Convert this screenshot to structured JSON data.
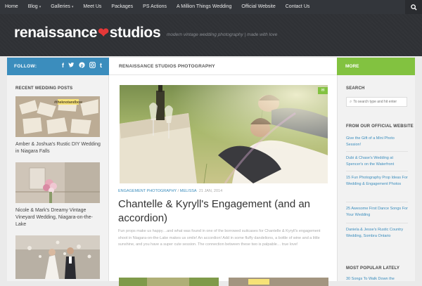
{
  "nav": {
    "items": [
      {
        "label": "Home"
      },
      {
        "label": "Blog",
        "caret": "▾"
      },
      {
        "label": "Galleries",
        "caret": "▾"
      },
      {
        "label": "Meet Us"
      },
      {
        "label": "Packages"
      },
      {
        "label": "PS Actions"
      },
      {
        "label": "A Million Things Wedding"
      },
      {
        "label": "Official Website"
      },
      {
        "label": "Contact Us"
      }
    ]
  },
  "header": {
    "logo_left": "renaissance",
    "logo_heart": "❤",
    "logo_right": "studios",
    "tagline": "modern vintage wedding photography | made with love"
  },
  "follow": {
    "label": "FOLLOW:",
    "icons": [
      "facebook-icon",
      "twitter-icon",
      "pinterest-icon",
      "instagram-icon",
      "tumblr-icon"
    ],
    "glyphs": [
      "f",
      "t",
      "p",
      "◎",
      "t"
    ]
  },
  "left": {
    "section_title": "RECENT WEDDING POSTS",
    "posts": [
      {
        "title": "Amber & Joshua's Rustic DIY Wedding in Niagara Falls"
      },
      {
        "title": "Nicole & Mark's Dreamy Vintage Vineyard Wedding, Niagara-on-the-Lake"
      }
    ]
  },
  "main": {
    "section_title": "RENAISSANCE STUDIOS PHOTOGRAPHY",
    "category": "ENGAGEMENT PHOTOGRAPHY",
    "author": "MELISSA",
    "date": "21 JAN, 2014",
    "comment_badge": "✉",
    "headline": "Chantelle & Kyryll's Engagement (and an accordion)",
    "excerpt": "Fun props make us happy…and what was found in one of the borrowed suitcases for Chantelle & Kyryll's engagement shoot in Niagara-on-the-Lake makes us smile! An accordion! Add in some fluffy dandelions, a bottle of wine and a little sunshine, and you have a super cute session. The connection between these two is palpable… true love!",
    "separator": "/"
  },
  "right": {
    "more_label": "MORE",
    "search_title": "SEARCH",
    "search_placeholder": "To search type and hit enter",
    "official_title": "FROM OUR OFFICIAL WEBSITE",
    "links": [
      {
        "text": "Give the Gift of a Mini Photo Session!"
      },
      {
        "text": "Dubi & Chase's Wedding at Spencer's on the Waterfront"
      },
      {
        "text": "15 Fun Photography Prop Ideas For Wedding & Engagement Photos"
      },
      {
        "text": "25 Awesome First Dance Songs For Your Wedding"
      },
      {
        "text": "Daniela & Jesse's Rustic Country Wedding, Sombra Ontario"
      }
    ],
    "popular_title": "MOST POPULAR LATELY",
    "popular_first": "30 Songs To Walk Down the"
  },
  "colors": {
    "accent_blue": "#3b8dbd",
    "accent_green": "#82c240",
    "topbar": "#33363b",
    "heart": "#e43838"
  }
}
